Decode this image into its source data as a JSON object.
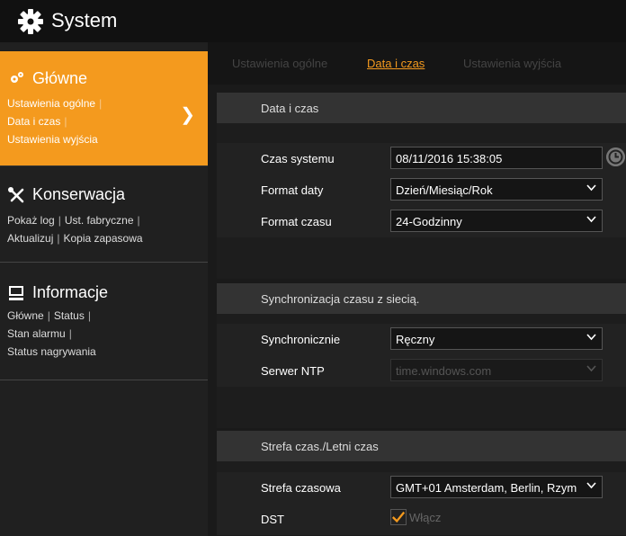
{
  "app": {
    "title": "System",
    "accent": "#f49a1e"
  },
  "sidebar": {
    "glowne": {
      "title": "Główne",
      "links": [
        "Ustawienia ogólne",
        "Data i czas",
        "Ustawienia wyjścia"
      ]
    },
    "konserwacja": {
      "title": "Konserwacja",
      "links": [
        "Pokaż log",
        "Ust. fabryczne",
        "Aktualizuj",
        "Kopia zapasowa"
      ]
    },
    "informacje": {
      "title": "Informacje",
      "links": [
        "Główne",
        "Status",
        "Stan alarmu",
        "Status nagrywania"
      ]
    }
  },
  "tabs": [
    {
      "label": "Ustawienia ogólne",
      "active": false
    },
    {
      "label": "Data i czas",
      "active": true
    },
    {
      "label": "Ustawienia wyjścia",
      "active": false
    }
  ],
  "sections": {
    "datetime": {
      "header": "Data i czas",
      "czas_systemu": {
        "label": "Czas systemu",
        "value": "08/11/2016 15:38:05"
      },
      "format_daty": {
        "label": "Format daty",
        "value": "Dzień/Miesiąc/Rok"
      },
      "format_czasu": {
        "label": "Format czasu",
        "value": "24-Godzinny"
      }
    },
    "sync": {
      "header": "Synchronizacja czasu z siecią.",
      "synchronicznie": {
        "label": "Synchronicznie",
        "value": "Ręczny"
      },
      "serwer_ntp": {
        "label": "Serwer NTP",
        "value": "time.windows.com"
      }
    },
    "tz": {
      "header": "Strefa czas./Letni czas",
      "strefa": {
        "label": "Strefa czasowa",
        "value": "GMT+01 Amsterdam, Berlin, Rzym"
      },
      "dst": {
        "label": "DST",
        "checkbox_label": "Włącz",
        "checked": true
      }
    }
  }
}
